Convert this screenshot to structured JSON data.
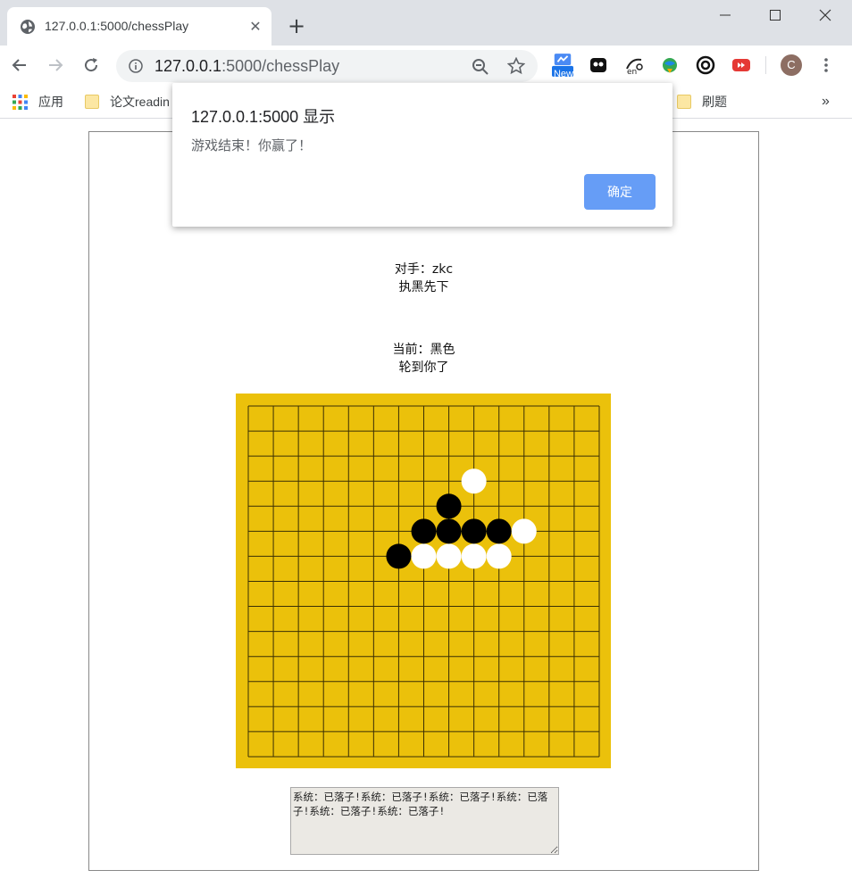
{
  "browser": {
    "tab_title": "127.0.0.1:5000/chessPlay",
    "url_host": "127.0.0.1",
    "url_rest": ":5000/chessPlay",
    "ext_new_badge": "New",
    "avatar_letter": "C",
    "bookmarks": {
      "apps_label": "应用",
      "item1": "论文readin",
      "item_right": "刷题",
      "overflow": "»"
    }
  },
  "dialog": {
    "title": "127.0.0.1:5000 显示",
    "message": "游戏结束！你赢了！",
    "ok_label": "确定"
  },
  "game": {
    "opponent": "对手：zkc",
    "role": "执黑先下",
    "current": "当前：黑色",
    "turn": "轮到你了",
    "board_size": 15,
    "stones": [
      {
        "row": 3,
        "col": 9,
        "color": "white"
      },
      {
        "row": 4,
        "col": 8,
        "color": "black"
      },
      {
        "row": 5,
        "col": 7,
        "color": "black"
      },
      {
        "row": 5,
        "col": 8,
        "color": "black"
      },
      {
        "row": 5,
        "col": 9,
        "color": "black"
      },
      {
        "row": 5,
        "col": 10,
        "color": "black"
      },
      {
        "row": 5,
        "col": 11,
        "color": "white"
      },
      {
        "row": 6,
        "col": 6,
        "color": "black"
      },
      {
        "row": 6,
        "col": 7,
        "color": "white"
      },
      {
        "row": 6,
        "col": 8,
        "color": "white"
      },
      {
        "row": 6,
        "col": 9,
        "color": "white"
      },
      {
        "row": 6,
        "col": 10,
        "color": "white"
      }
    ],
    "log": "系统：已落子!系统：已落子!系统：已落子!系统：已落子!系统：已落子!系统：已落子!"
  },
  "colors": {
    "board": "#ebc10b",
    "grid": "#3a2f05",
    "black_stone": "#000000",
    "white_stone": "#ffffff",
    "ok_button": "#669df6"
  }
}
